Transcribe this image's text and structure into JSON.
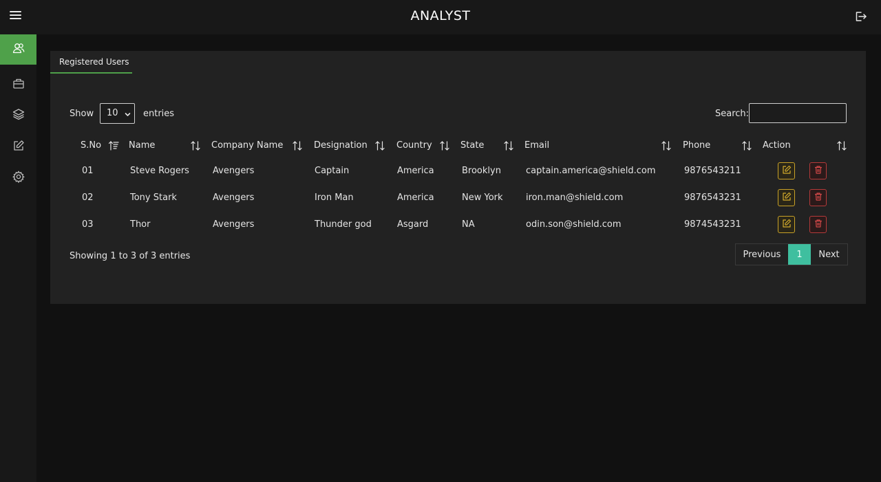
{
  "header": {
    "title": "ANALYST"
  },
  "sidebar": {
    "items": [
      {
        "icon": "users-icon",
        "active": true
      },
      {
        "icon": "briefcase-icon",
        "active": false
      },
      {
        "icon": "layers-icon",
        "active": false
      },
      {
        "icon": "edit-icon",
        "active": false
      },
      {
        "icon": "gear-icon",
        "active": false
      }
    ]
  },
  "panel": {
    "tab_label": "Registered Users",
    "show_label": "Show",
    "entries_value": "10",
    "entries_label": "entries",
    "search_label": "Search:",
    "search_value": ""
  },
  "table": {
    "columns": [
      "S.No",
      "Name",
      "Company Name",
      "Designation",
      "Country",
      "State",
      "Email",
      "Phone",
      "Action"
    ],
    "rows": [
      {
        "sno": "01",
        "name": "Steve Rogers",
        "company": "Avengers",
        "designation": "Captain",
        "country": "America",
        "state": "Brooklyn",
        "email": "captain.america@shield.com",
        "phone": "9876543211"
      },
      {
        "sno": "02",
        "name": "Tony Stark",
        "company": "Avengers",
        "designation": "Iron Man",
        "country": "America",
        "state": "New York",
        "email": "iron.man@shield.com",
        "phone": "9876543231"
      },
      {
        "sno": "03",
        "name": "Thor",
        "company": "Avengers",
        "designation": "Thunder god",
        "country": "Asgard",
        "state": "NA",
        "email": "odin.son@shield.com",
        "phone": "9874543231"
      }
    ]
  },
  "footer": {
    "info": "Showing 1 to 3 of 3 entries",
    "prev_label": "Previous",
    "page_number": "1",
    "next_label": "Next"
  },
  "colors": {
    "accent": "#4fa14a",
    "page_active": "#3fbf9f",
    "edit": "#c9a227",
    "delete": "#b63a3a"
  }
}
